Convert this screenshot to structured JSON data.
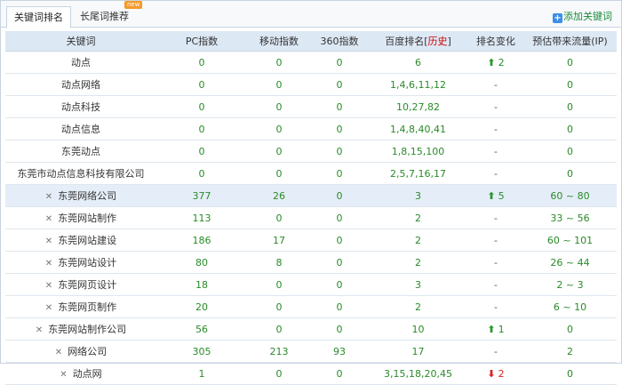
{
  "tabs": {
    "active": "关键词排名",
    "inactive": "长尾词推荐",
    "badge": "new"
  },
  "actions": {
    "add_keyword": "添加关键词"
  },
  "table": {
    "headers": {
      "keyword": "关键词",
      "pc": "PC指数",
      "mobile": "移动指数",
      "s360": "360指数",
      "baidu_prefix": "百度排名[",
      "history": "历史",
      "baidu_suffix": "]",
      "change": "排名变化",
      "traffic": "预估带来流量(IP)"
    },
    "rows": [
      {
        "keyword": "动点",
        "pc": "0",
        "mobile": "0",
        "s360": "0",
        "rank": "6",
        "change": "2",
        "change_dir": "up",
        "traffic": "0",
        "deletable": false
      },
      {
        "keyword": "动点网络",
        "pc": "0",
        "mobile": "0",
        "s360": "0",
        "rank": "1,4,6,11,12",
        "change": "-",
        "change_dir": "none",
        "traffic": "0",
        "deletable": false
      },
      {
        "keyword": "动点科技",
        "pc": "0",
        "mobile": "0",
        "s360": "0",
        "rank": "10,27,82",
        "change": "-",
        "change_dir": "none",
        "traffic": "0",
        "deletable": false
      },
      {
        "keyword": "动点信息",
        "pc": "0",
        "mobile": "0",
        "s360": "0",
        "rank": "1,4,8,40,41",
        "change": "-",
        "change_dir": "none",
        "traffic": "0",
        "deletable": false
      },
      {
        "keyword": "东莞动点",
        "pc": "0",
        "mobile": "0",
        "s360": "0",
        "rank": "1,8,15,100",
        "change": "-",
        "change_dir": "none",
        "traffic": "0",
        "deletable": false
      },
      {
        "keyword": "东莞市动点信息科技有限公司",
        "pc": "0",
        "mobile": "0",
        "s360": "0",
        "rank": "2,5,7,16,17",
        "change": "-",
        "change_dir": "none",
        "traffic": "0",
        "deletable": false
      },
      {
        "keyword": "东莞网络公司",
        "pc": "377",
        "mobile": "26",
        "s360": "0",
        "rank": "3",
        "change": "5",
        "change_dir": "up",
        "traffic": "60 ~ 80",
        "deletable": true,
        "highlight": true
      },
      {
        "keyword": "东莞网站制作",
        "pc": "113",
        "mobile": "0",
        "s360": "0",
        "rank": "2",
        "change": "-",
        "change_dir": "none",
        "traffic": "33 ~ 56",
        "deletable": true
      },
      {
        "keyword": "东莞网站建设",
        "pc": "186",
        "mobile": "17",
        "s360": "0",
        "rank": "2",
        "change": "-",
        "change_dir": "none",
        "traffic": "60 ~ 101",
        "deletable": true
      },
      {
        "keyword": "东莞网站设计",
        "pc": "80",
        "mobile": "8",
        "s360": "0",
        "rank": "2",
        "change": "-",
        "change_dir": "none",
        "traffic": "26 ~ 44",
        "deletable": true
      },
      {
        "keyword": "东莞网页设计",
        "pc": "18",
        "mobile": "0",
        "s360": "0",
        "rank": "3",
        "change": "-",
        "change_dir": "none",
        "traffic": "2 ~ 3",
        "deletable": true
      },
      {
        "keyword": "东莞网页制作",
        "pc": "20",
        "mobile": "0",
        "s360": "0",
        "rank": "2",
        "change": "-",
        "change_dir": "none",
        "traffic": "6 ~ 10",
        "deletable": true
      },
      {
        "keyword": "东莞网站制作公司",
        "pc": "56",
        "mobile": "0",
        "s360": "0",
        "rank": "10",
        "change": "1",
        "change_dir": "up",
        "traffic": "0",
        "deletable": true
      },
      {
        "keyword": "网络公司",
        "pc": "305",
        "mobile": "213",
        "s360": "93",
        "rank": "17",
        "change": "-",
        "change_dir": "none",
        "traffic": "2",
        "deletable": true
      },
      {
        "keyword": "动点网",
        "pc": "1",
        "mobile": "0",
        "s360": "0",
        "rank": "3,15,18,20,45",
        "change": "2",
        "change_dir": "down",
        "traffic": "0",
        "deletable": true
      }
    ]
  },
  "icons": {
    "delete": "close-icon",
    "up": "arrow-up-icon",
    "down": "arrow-down-icon",
    "add": "plus-icon"
  },
  "colors": {
    "header_bg": "#dde8f5",
    "highlight_bg": "#e5eef8",
    "value_green": "#2a8a2a",
    "history_red": "#cc0000",
    "add_link_green": "#1a8c3b"
  }
}
